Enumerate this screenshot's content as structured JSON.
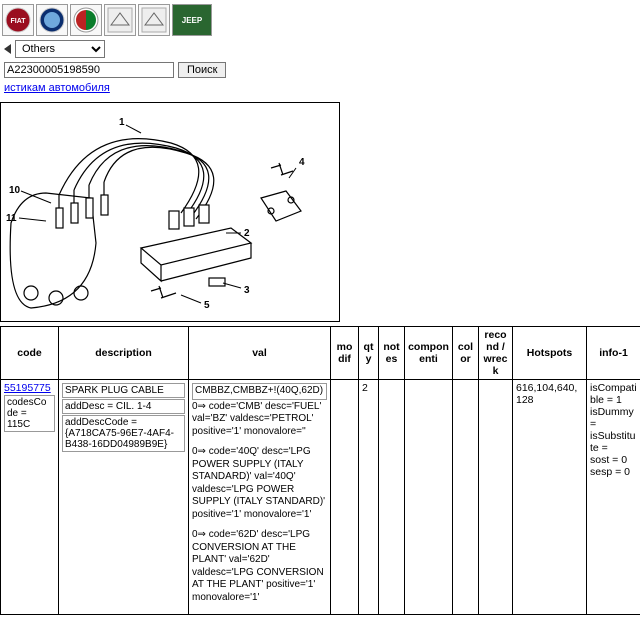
{
  "brands": [
    "FIAT",
    "LANCIA",
    "ALFA",
    "CHRY",
    "CHRY",
    "JEEP"
  ],
  "dropdown": {
    "selected": "Others"
  },
  "search": {
    "value": "A22300005198590",
    "button": "Поиск"
  },
  "nav_link": "истикам автомобиля",
  "diagram": {
    "callouts": [
      "1",
      "10",
      "11",
      "4",
      "2",
      "5",
      "3"
    ]
  },
  "table": {
    "headers": [
      "code",
      "description",
      "val",
      "modif",
      "qty",
      "notes",
      "componenti",
      "color",
      "recond / wreck",
      "Hotspots",
      "info-1"
    ],
    "row": {
      "code_link": "55195775",
      "code_sub_label": "codesCode",
      "code_sub_val": "= 115C",
      "desc_line1": "SPARK PLUG CABLE",
      "desc_line2": "addDesc = CIL. 1-4",
      "desc_line3": "addDescCode = {A718CA75-96E7-4AF4-B438-16DD04989B9E}",
      "val_top": "CMBBZ,CMBBZ+!(40Q,62D)",
      "val_b1": "0⇒ code='CMB' desc='FUEL' val='BZ' valdesc='PETROL' positive='1' monovalore=''",
      "val_b2": "0⇒ code='40Q' desc='LPG POWER SUPPLY (ITALY STANDARD)' val='40Q' valdesc='LPG POWER SUPPLY (ITALY STANDARD)' positive='1' monovalore='1'",
      "val_b3": "0⇒ code='62D' desc='LPG CONVERSION AT THE PLANT' val='62D' valdesc='LPG CONVERSION AT THE PLANT' positive='1' monovalore='1'",
      "qty": "2",
      "hotspots": "616,104,640,128",
      "info": "isCompatible = 1\nisDummy =\nisSubstitute =\nsost = 0\nsesp = 0"
    }
  }
}
